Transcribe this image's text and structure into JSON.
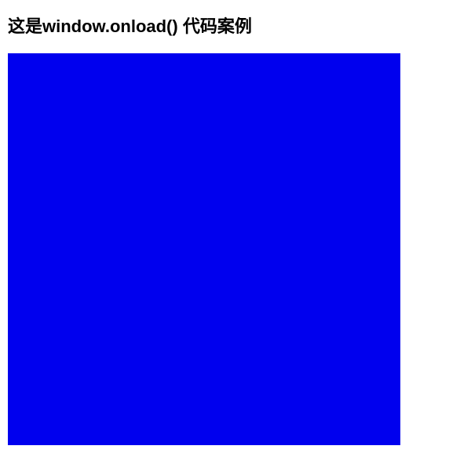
{
  "heading": "这是window.onload() 代码案例",
  "box": {
    "color": "#0000ee"
  }
}
